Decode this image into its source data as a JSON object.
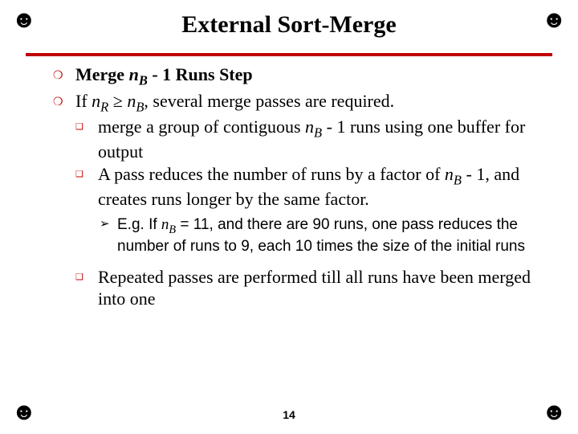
{
  "title": "External Sort-Merge",
  "bullets": {
    "item1_pre": "Merge ",
    "item1_post": " - 1 Runs Step",
    "item2_pre": "If ",
    "item2_mid": " ≥ ",
    "item2_post": ", several merge passes are required.",
    "sub1_pre": "merge a group of contiguous ",
    "sub1_post": " - 1 runs using one buffer for output",
    "sub2_pre": "A pass reduces the number of runs by a factor of ",
    "sub2_post": " - 1, and creates runs longer by the same factor.",
    "sub3_pre": "E.g.  If ",
    "sub3_post": " = 11, and there are 90 runs, one pass reduces the number of runs to 9, each 10 times the size of the initial runs",
    "sub4": "Repeated passes are performed till all runs have been merged into one"
  },
  "vars": {
    "nB": "n",
    "nB_sub": "B",
    "nR": "n",
    "nR_sub": "R"
  },
  "icons": {
    "corner": "☻",
    "circle": "❍",
    "square": "❑",
    "arrow": "➢"
  },
  "page": "14"
}
